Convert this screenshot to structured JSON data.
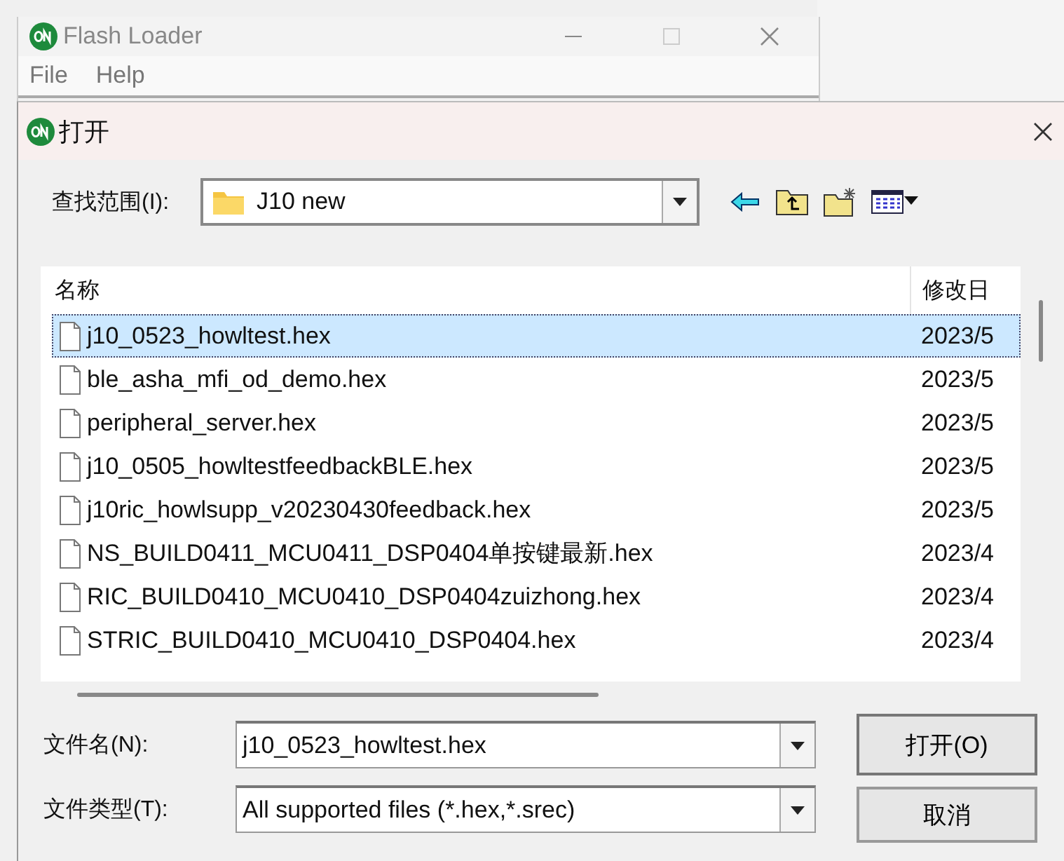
{
  "background_window": {
    "title": "Flash Loader",
    "menu": [
      "File",
      "Help"
    ]
  },
  "dialog": {
    "title": "打开",
    "look_in": {
      "label": "查找范围(I):",
      "value": "J10 new"
    },
    "file_list": {
      "columns": [
        "名称",
        "修改日"
      ],
      "rows": [
        {
          "name": "j10_0523_howltest.hex",
          "date": "2023/5",
          "selected": true
        },
        {
          "name": "ble_asha_mfi_od_demo.hex",
          "date": "2023/5",
          "selected": false
        },
        {
          "name": "peripheral_server.hex",
          "date": "2023/5",
          "selected": false
        },
        {
          "name": "j10_0505_howltestfeedbackBLE.hex",
          "date": "2023/5",
          "selected": false
        },
        {
          "name": "j10ric_howlsupp_v20230430feedback.hex",
          "date": "2023/5",
          "selected": false
        },
        {
          "name": "NS_BUILD0411_MCU0411_DSP0404单按键最新.hex",
          "date": "2023/4",
          "selected": false
        },
        {
          "name": "RIC_BUILD0410_MCU0410_DSP0404zuizhong.hex",
          "date": "2023/4",
          "selected": false
        },
        {
          "name": "STRIC_BUILD0410_MCU0410_DSP0404.hex",
          "date": "2023/4",
          "selected": false
        }
      ]
    },
    "file_name": {
      "label": "文件名(N):",
      "value": "j10_0523_howltest.hex"
    },
    "file_type": {
      "label": "文件类型(T):",
      "value": "All supported files (*.hex,*.srec)"
    },
    "buttons": [
      "打开(O)",
      "取消"
    ]
  }
}
